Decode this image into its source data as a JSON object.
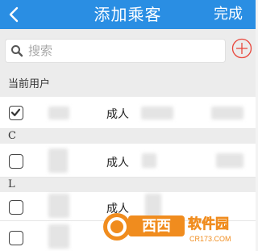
{
  "header": {
    "title": "添加乘客",
    "done_label": "完成"
  },
  "search": {
    "placeholder": "搜索"
  },
  "sections": [
    {
      "label": "当前用户"
    },
    {
      "label": "C"
    },
    {
      "label": "L"
    }
  ],
  "passengers": [
    {
      "type": "成人",
      "checked": true
    },
    {
      "type": "成人",
      "checked": false
    },
    {
      "type": "成人",
      "checked": false
    },
    {
      "type": "",
      "checked": false
    }
  ],
  "watermark": {
    "brand": "西西软件园",
    "domain": "CR173.COM"
  },
  "colors": {
    "header": "#2a8ee3",
    "add_icon": "#e9453a",
    "watermark_orange": "#f08c1e"
  },
  "icons": {
    "back": "chevron-left-icon",
    "search": "search-icon",
    "add": "add-circle-icon"
  }
}
